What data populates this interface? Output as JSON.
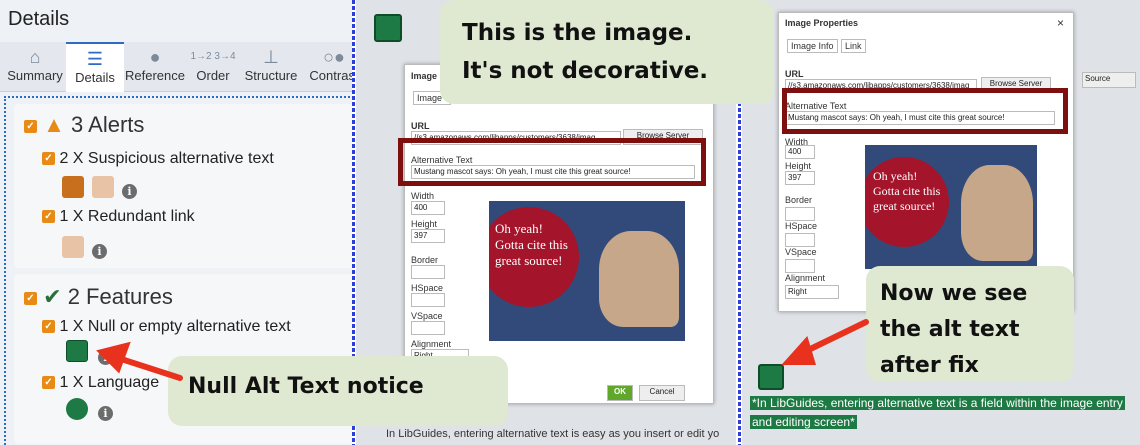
{
  "panel": {
    "title": "Details",
    "tabs": [
      {
        "label": "Summary"
      },
      {
        "label": "Details"
      },
      {
        "label": "Reference"
      },
      {
        "label": "Order"
      },
      {
        "label": "Structure"
      },
      {
        "label": "Contrast"
      }
    ],
    "alerts": {
      "heading": "3 Alerts",
      "items": [
        "2 X Suspicious alternative text",
        "1 X Redundant link"
      ]
    },
    "features": {
      "heading": "2 Features",
      "items": [
        "1 X Null or empty alternative text",
        "1 X Language"
      ]
    }
  },
  "callouts": {
    "image": "This is the image.\nIt's not decorative.",
    "null_alt": "Null Alt Text notice",
    "fixed": "Now we see\nthe alt text\nafter fix"
  },
  "dialog": {
    "title": "Image Properties",
    "tab_info": "Image Info",
    "tab_link": "Link",
    "url_label": "URL",
    "url_value": "//s3.amazonaws.com/libapps/customers/3638/imag",
    "browse": "Browse Server",
    "alt_label": "Alternative Text",
    "alt_value": "Mustang mascot says: Oh yeah, I must cite this great source!",
    "width_label": "Width",
    "width": "400",
    "height_label": "Height",
    "height": "397",
    "border_label": "Border",
    "hspace_label": "HSpace",
    "vspace_label": "VSpace",
    "align_label": "Alignment",
    "align_value": "Right",
    "ok": "OK",
    "cancel": "Cancel",
    "preview_text": "Oh yeah!\nGotta cite this\ngreat source!"
  },
  "mid": {
    "footer": "In LibGuides, entering alternative text is easy as you insert or edit yo",
    "dlg_title_short": "Image I",
    "tab_short": "Image I"
  },
  "right": {
    "footer": "*In LibGuides, entering alternative text is a field within the image entry and editing screen*",
    "source": "Source"
  }
}
